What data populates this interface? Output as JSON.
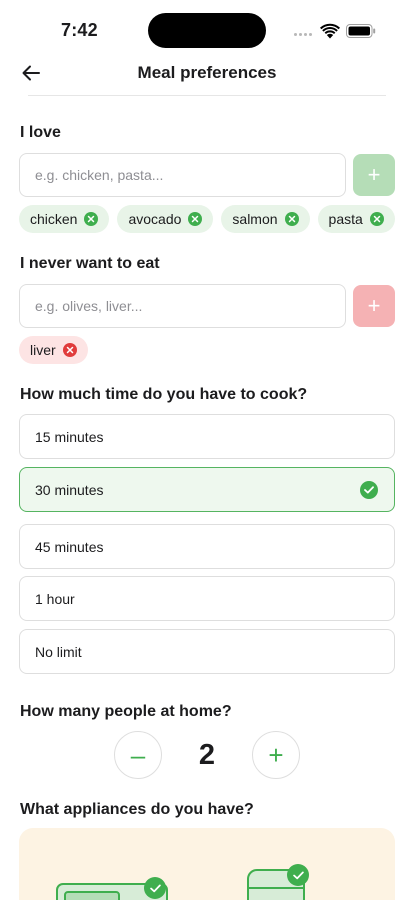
{
  "status_bar": {
    "time": "7:42"
  },
  "header": {
    "title": "Meal preferences",
    "back_icon": "arrow-left-icon"
  },
  "love": {
    "title": "I love",
    "placeholder": "e.g. chicken, pasta...",
    "chips": [
      "chicken",
      "avocado",
      "salmon",
      "pasta"
    ]
  },
  "never": {
    "title": "I never want to eat",
    "placeholder": "e.g. olives, liver...",
    "chips": [
      "liver"
    ]
  },
  "cook_time": {
    "title": "How much time do you have to cook?",
    "options": [
      "15 minutes",
      "30 minutes",
      "45 minutes",
      "1 hour",
      "No limit"
    ],
    "selected": "30 minutes"
  },
  "people": {
    "title": "How many people at home?",
    "value": "2",
    "minus": "–",
    "plus": "+"
  },
  "appliances": {
    "title": "What appliances do you have?"
  },
  "colors": {
    "accent_green": "#3fae4e",
    "add_button_green": "#b5ddb7",
    "add_button_red": "#f5b2b4",
    "chip_green_bg": "#e8f4e8",
    "chip_red_bg": "#fde4e4",
    "selected_bg": "#eef8ee",
    "appliance_bg": "#fdf3e3"
  }
}
